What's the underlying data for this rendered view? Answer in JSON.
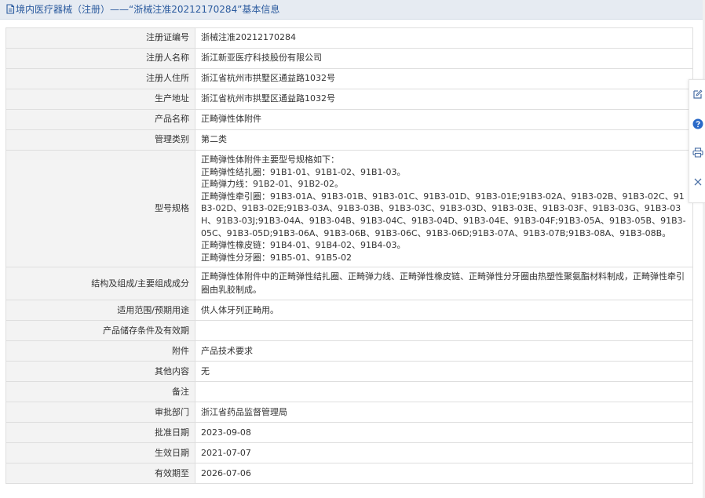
{
  "header": {
    "title": "境内医疗器械（注册）——“浙械注准20212170284”基本信息"
  },
  "rows": [
    {
      "label": "注册证编号",
      "value": "浙械注准20212170284"
    },
    {
      "label": "注册人名称",
      "value": "浙江新亚医疗科技股份有限公司"
    },
    {
      "label": "注册人住所",
      "value": "浙江省杭州市拱墅区通益路1032号"
    },
    {
      "label": "生产地址",
      "value": "浙江省杭州市拱墅区通益路1032号"
    },
    {
      "label": "产品名称",
      "value": "正畸弹性体附件"
    },
    {
      "label": "管理类别",
      "value": "第二类"
    }
  ],
  "model_row": {
    "label": "型号规格",
    "lines": [
      "正畸弹性体附件主要型号规格如下：",
      "正畸弹性结扎圈：91B1-01、91B1-02、91B1-03。",
      "正畸弹力线：91B2-01、91B2-02。",
      "正畸弹性牵引圈：91B3-01A、91B3-01B、91B3-01C、91B3-01D、91B3-01E;91B3-02A、91B3-02B、91B3-02C、91B3-02D、91B3-02E;91B3-03A、91B3-03B、91B3-03C、91B3-03D、91B3-03E、91B3-03F、91B3-03G、91B3-03H、91B3-03J;91B3-04A、91B3-04B、91B3-04C、91B3-04D、91B3-04E、91B3-04F;91B3-05A、91B3-05B、91B3-05C、91B3-05D;91B3-06A、91B3-06B、91B3-06C、91B3-06D;91B3-07A、91B3-07B;91B3-08A、91B3-08B。",
      "正畸弹性橡皮链：91B4-01、91B4-02、91B4-03。",
      "正畸弹性分牙圈：91B5-01、91B5-02"
    ]
  },
  "rows2": [
    {
      "label": "结构及组成/主要组成成分",
      "value": "正畸弹性体附件中的正畸弹性结扎圈、正畸弹力线、正畸弹性橡皮链、正畸弹性分牙圈由热塑性聚氨酯材料制成，正畸弹性牵引圈由乳胶制成。"
    },
    {
      "label": "适用范围/预期用途",
      "value": "供人体牙列正畸用。"
    },
    {
      "label": "产品储存条件及有效期",
      "value": ""
    },
    {
      "label": "附件",
      "value": "产品技术要求"
    },
    {
      "label": "其他内容",
      "value": "无"
    },
    {
      "label": "备注",
      "value": ""
    },
    {
      "label": "审批部门",
      "value": "浙江省药品监督管理局"
    },
    {
      "label": "批准日期",
      "value": "2023-09-08"
    },
    {
      "label": "生效日期",
      "value": "2021-07-07"
    },
    {
      "label": "有效期至",
      "value": "2026-07-06"
    }
  ],
  "side_tools": [
    {
      "name": "edit-icon"
    },
    {
      "name": "help-icon"
    },
    {
      "name": "print-icon"
    },
    {
      "name": "close-icon"
    }
  ],
  "colors": {
    "header_bg": "#e6ebf2",
    "title_text": "#2a5a9e",
    "label_bg": "#f3f3f3",
    "border": "#dedede",
    "help_icon": "#2a6ac8"
  }
}
